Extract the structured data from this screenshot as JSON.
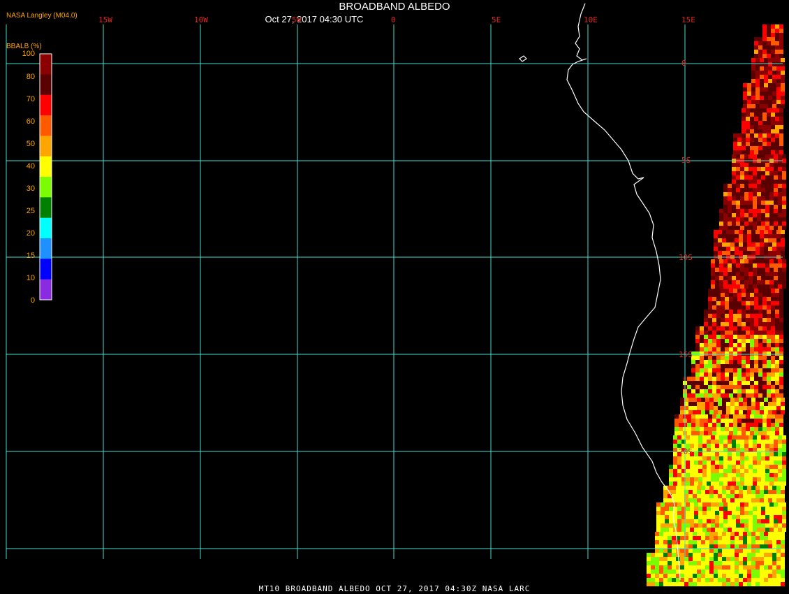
{
  "header": {
    "title": "BROADBAND ALBEDO",
    "datetime": "Oct 27, 2017 04:30 UTC",
    "credit": "NASA Langley (M04.0)"
  },
  "legend": {
    "title": "BBALB (%)",
    "ticks": [
      "100",
      "80",
      "70",
      "60",
      "50",
      "40",
      "30",
      "25",
      "20",
      "15",
      "10",
      "0"
    ],
    "bins": [
      {
        "color": "#8b0000"
      },
      {
        "color": "#5a0000"
      },
      {
        "color": "#ff0000"
      },
      {
        "color": "#ff5a00"
      },
      {
        "color": "#ffa500"
      },
      {
        "color": "#ffff00"
      },
      {
        "color": "#7cfc00"
      },
      {
        "color": "#008000"
      },
      {
        "color": "#00ffff"
      },
      {
        "color": "#1e90ff"
      },
      {
        "color": "#0000ff"
      },
      {
        "color": "#8a2be2"
      }
    ]
  },
  "grid": {
    "color": "#40e0d0",
    "lon_labels": [
      "15W",
      "10W",
      "5W",
      "0",
      "5E",
      "10E",
      "15E"
    ],
    "lat_labels": [
      "0",
      "5S",
      "10S",
      "15S",
      "20S"
    ]
  },
  "footer": {
    "text": "MT10  BROADBAND ALBEDO   OCT 27, 2017 04:30Z   NASA LARC"
  }
}
